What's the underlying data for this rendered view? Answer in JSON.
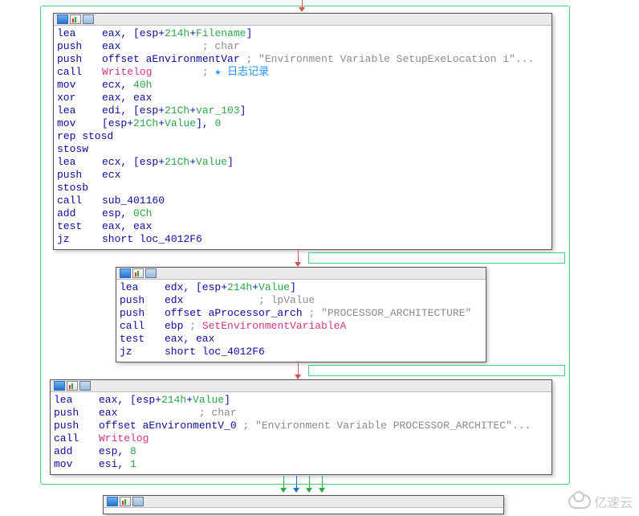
{
  "watermark": "亿速云",
  "blocks": {
    "b1": {
      "lines": [
        [
          {
            "t": "lea",
            "c": "mnem"
          },
          {
            "t": "eax, [esp+",
            "c": "reg"
          },
          {
            "t": "214h",
            "c": "num"
          },
          {
            "t": "+",
            "c": "reg"
          },
          {
            "t": "Filename",
            "c": "num"
          },
          {
            "t": "]",
            "c": "reg"
          }
        ],
        [
          {
            "t": "push",
            "c": "mnem"
          },
          {
            "t": "eax",
            "c": "reg"
          },
          {
            "t": "             ; char",
            "c": "cm"
          }
        ],
        [
          {
            "t": "push",
            "c": "mnem"
          },
          {
            "t": "offset aEnvironmentVar ",
            "c": "reg"
          },
          {
            "t": "; \"Environment Variable SetupExeLocation i\"",
            "c": "str"
          },
          {
            "t": "...",
            "c": "ellips"
          }
        ],
        [
          {
            "t": "call",
            "c": "mnem"
          },
          {
            "t": "Writelog",
            "c": "func"
          },
          {
            "t": "        ; ",
            "c": "cm"
          },
          {
            "t": "★ 日志记录",
            "c": "star"
          }
        ],
        [
          {
            "t": "mov",
            "c": "mnem"
          },
          {
            "t": "ecx, ",
            "c": "reg"
          },
          {
            "t": "40h",
            "c": "num"
          }
        ],
        [
          {
            "t": "xor",
            "c": "mnem"
          },
          {
            "t": "eax, eax",
            "c": "reg"
          }
        ],
        [
          {
            "t": "lea",
            "c": "mnem"
          },
          {
            "t": "edi, [esp+",
            "c": "reg"
          },
          {
            "t": "21Ch",
            "c": "num"
          },
          {
            "t": "+",
            "c": "reg"
          },
          {
            "t": "var_103",
            "c": "num"
          },
          {
            "t": "]",
            "c": "reg"
          }
        ],
        [
          {
            "t": "mov",
            "c": "mnem"
          },
          {
            "t": "[esp+",
            "c": "reg"
          },
          {
            "t": "21Ch",
            "c": "num"
          },
          {
            "t": "+",
            "c": "reg"
          },
          {
            "t": "Value",
            "c": "num"
          },
          {
            "t": "], ",
            "c": "reg"
          },
          {
            "t": "0",
            "c": "num"
          }
        ],
        [
          {
            "t": "rep stosd",
            "c": "reg"
          }
        ],
        [
          {
            "t": "stosw",
            "c": "reg"
          }
        ],
        [
          {
            "t": "lea",
            "c": "mnem"
          },
          {
            "t": "ecx, [esp+",
            "c": "reg"
          },
          {
            "t": "21Ch",
            "c": "num"
          },
          {
            "t": "+",
            "c": "reg"
          },
          {
            "t": "Value",
            "c": "num"
          },
          {
            "t": "]",
            "c": "reg"
          }
        ],
        [
          {
            "t": "push",
            "c": "mnem"
          },
          {
            "t": "ecx",
            "c": "reg"
          }
        ],
        [
          {
            "t": "stosb",
            "c": "reg"
          }
        ],
        [
          {
            "t": "call",
            "c": "mnem"
          },
          {
            "t": "sub_401160",
            "c": "reg"
          }
        ],
        [
          {
            "t": "add",
            "c": "mnem"
          },
          {
            "t": "esp, ",
            "c": "reg"
          },
          {
            "t": "0Ch",
            "c": "num"
          }
        ],
        [
          {
            "t": "test",
            "c": "mnem"
          },
          {
            "t": "eax, eax",
            "c": "reg"
          }
        ],
        [
          {
            "t": "jz",
            "c": "mnem"
          },
          {
            "t": "short loc_4012F6",
            "c": "reg"
          }
        ]
      ]
    },
    "b2": {
      "lines": [
        [
          {
            "t": "lea",
            "c": "mnem"
          },
          {
            "t": "edx, [esp+",
            "c": "reg"
          },
          {
            "t": "214h",
            "c": "num"
          },
          {
            "t": "+",
            "c": "reg"
          },
          {
            "t": "Value",
            "c": "num"
          },
          {
            "t": "]",
            "c": "reg"
          }
        ],
        [
          {
            "t": "push",
            "c": "mnem"
          },
          {
            "t": "edx",
            "c": "reg"
          },
          {
            "t": "            ; lpValue",
            "c": "cm"
          }
        ],
        [
          {
            "t": "push",
            "c": "mnem"
          },
          {
            "t": "offset aProcessor_arch ",
            "c": "reg"
          },
          {
            "t": "; \"PROCESSOR_ARCHITECTURE\"",
            "c": "str"
          }
        ],
        [
          {
            "t": "call",
            "c": "mnem"
          },
          {
            "t": "ebp ",
            "c": "reg"
          },
          {
            "t": "; ",
            "c": "cm"
          },
          {
            "t": "SetEnvironmentVariableA",
            "c": "func"
          }
        ],
        [
          {
            "t": "test",
            "c": "mnem"
          },
          {
            "t": "eax, eax",
            "c": "reg"
          }
        ],
        [
          {
            "t": "jz",
            "c": "mnem"
          },
          {
            "t": "short loc_4012F6",
            "c": "reg"
          }
        ]
      ]
    },
    "b3": {
      "lines": [
        [
          {
            "t": "lea",
            "c": "mnem"
          },
          {
            "t": "eax, [esp+",
            "c": "reg"
          },
          {
            "t": "214h",
            "c": "num"
          },
          {
            "t": "+",
            "c": "reg"
          },
          {
            "t": "Value",
            "c": "num"
          },
          {
            "t": "]",
            "c": "reg"
          }
        ],
        [
          {
            "t": "push",
            "c": "mnem"
          },
          {
            "t": "eax",
            "c": "reg"
          },
          {
            "t": "             ; char",
            "c": "cm"
          }
        ],
        [
          {
            "t": "push",
            "c": "mnem"
          },
          {
            "t": "offset aEnvironmentV_0 ",
            "c": "reg"
          },
          {
            "t": "; \"Environment Variable PROCESSOR_ARCHITEC\"",
            "c": "str"
          },
          {
            "t": "...",
            "c": "ellips"
          }
        ],
        [
          {
            "t": "call",
            "c": "mnem"
          },
          {
            "t": "Writelog",
            "c": "func"
          }
        ],
        [
          {
            "t": "add",
            "c": "mnem"
          },
          {
            "t": "esp, ",
            "c": "reg"
          },
          {
            "t": "8",
            "c": "num"
          }
        ],
        [
          {
            "t": "mov",
            "c": "mnem"
          },
          {
            "t": "esi, ",
            "c": "reg"
          },
          {
            "t": "1",
            "c": "num"
          }
        ]
      ]
    }
  }
}
